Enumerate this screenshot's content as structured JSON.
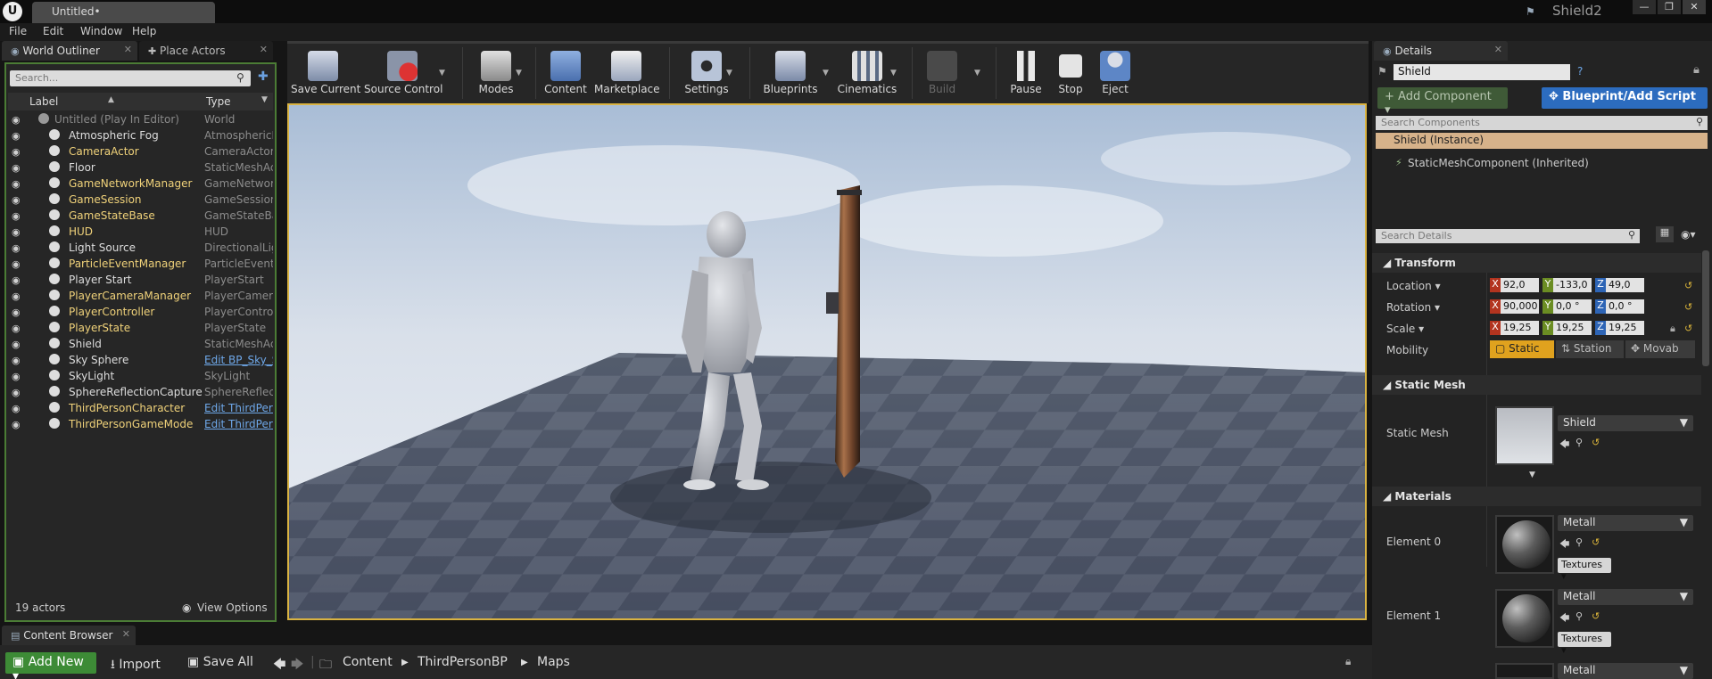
{
  "window": {
    "logo": "U",
    "document_tab": "Untitled•",
    "project_name": "Shield2",
    "controls": [
      "—",
      "❐",
      "✕"
    ]
  },
  "menu": [
    "File",
    "Edit",
    "Window",
    "Help"
  ],
  "left_tabs": {
    "world_outliner": "World Outliner",
    "place_actors": "Place Actors"
  },
  "outliner": {
    "search_placeholder": "Search...",
    "col_label": "Label",
    "col_type": "Type",
    "rows": [
      {
        "label": "Untitled (Play In Editor)",
        "type": "World",
        "style": "dim"
      },
      {
        "label": "Atmospheric Fog",
        "type": "AtmosphericFog",
        "style": "white"
      },
      {
        "label": "CameraActor",
        "type": "CameraActor",
        "style": "yellow"
      },
      {
        "label": "Floor",
        "type": "StaticMeshActor",
        "style": "white"
      },
      {
        "label": "GameNetworkManager",
        "type": "GameNetworkManager",
        "style": "yellow"
      },
      {
        "label": "GameSession",
        "type": "GameSession",
        "style": "yellow"
      },
      {
        "label": "GameStateBase",
        "type": "GameStateBase",
        "style": "yellow"
      },
      {
        "label": "HUD",
        "type": "HUD",
        "style": "yellow"
      },
      {
        "label": "Light Source",
        "type": "DirectionalLight",
        "style": "white"
      },
      {
        "label": "ParticleEventManager",
        "type": "ParticleEventManager",
        "style": "yellow"
      },
      {
        "label": "Player Start",
        "type": "PlayerStart",
        "style": "white"
      },
      {
        "label": "PlayerCameraManager",
        "type": "PlayerCameraManager",
        "style": "yellow"
      },
      {
        "label": "PlayerController",
        "type": "PlayerController",
        "style": "yellow"
      },
      {
        "label": "PlayerState",
        "type": "PlayerState",
        "style": "yellow"
      },
      {
        "label": "Shield",
        "type": "StaticMeshActor",
        "style": "white"
      },
      {
        "label": "Sky Sphere",
        "type": "Edit BP_Sky_Sphere",
        "style": "white",
        "link": true
      },
      {
        "label": "SkyLight",
        "type": "SkyLight",
        "style": "white"
      },
      {
        "label": "SphereReflectionCapture",
        "type": "SphereReflectionCapture",
        "style": "white"
      },
      {
        "label": "ThirdPersonCharacter",
        "type": "Edit ThirdPersonCharacter",
        "style": "yellow",
        "link": true
      },
      {
        "label": "ThirdPersonGameMode",
        "type": "Edit ThirdPersonGameMode",
        "style": "yellow",
        "link": true
      }
    ],
    "actor_count": "19 actors",
    "view_options": "View Options"
  },
  "toolbar": {
    "buttons": [
      {
        "label": "Save Current"
      },
      {
        "label": "Source Control"
      },
      {
        "label": "Modes"
      },
      {
        "label": "Content"
      },
      {
        "label": "Marketplace"
      },
      {
        "label": "Settings"
      },
      {
        "label": "Blueprints"
      },
      {
        "label": "Cinematics"
      },
      {
        "label": "Build"
      },
      {
        "label": "Pause"
      },
      {
        "label": "Stop"
      },
      {
        "label": "Eject"
      }
    ]
  },
  "details": {
    "tab": "Details",
    "actor_name": "Shield",
    "add_component": "+ Add Component ▾",
    "blueprint_script": "Blueprint/Add Script",
    "search_components_placeholder": "Search Components",
    "selected_component": "Shield (Instance)",
    "child_component": "StaticMeshComponent (Inherited)",
    "search_details_placeholder": "Search Details",
    "transform": {
      "title": "Transform",
      "location": {
        "label": "Location ▾",
        "x": "92,0",
        "y": "-133,0",
        "z": "49,0"
      },
      "rotation": {
        "label": "Rotation ▾",
        "x": "90,000",
        "y": "0,0 °",
        "z": "0,0 °"
      },
      "scale": {
        "label": "Scale ▾",
        "x": "19,25",
        "y": "19,25",
        "z": "19,25"
      },
      "mobility_label": "Mobility",
      "mobility_options": [
        "Static",
        "Station",
        "Movab"
      ]
    },
    "static_mesh": {
      "title": "Static Mesh",
      "label": "Static Mesh",
      "value": "Shield"
    },
    "materials": {
      "title": "Materials",
      "elements": [
        {
          "label": "Element 0",
          "value": "Metall",
          "textures": "Textures ▾"
        },
        {
          "label": "Element 1",
          "value": "Metall",
          "textures": "Textures ▾"
        },
        {
          "label": "",
          "value": "Metall",
          "textures": ""
        }
      ]
    }
  },
  "content_browser": {
    "tab": "Content Browser",
    "add_new": "Add New ▾",
    "import": "Import",
    "save_all": "Save All",
    "breadcrumbs": [
      "Content",
      "ThirdPersonBP",
      "Maps"
    ]
  }
}
